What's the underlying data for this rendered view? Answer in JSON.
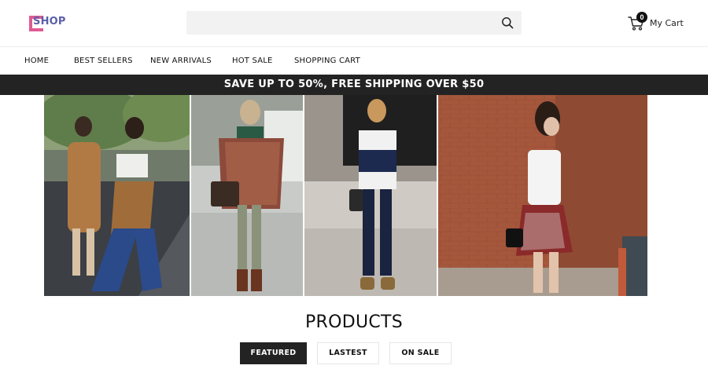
{
  "header": {
    "logo_text": "SHOP",
    "search": {
      "placeholder": "",
      "value": ""
    },
    "cart": {
      "count": "0",
      "label": "My Cart"
    }
  },
  "nav": {
    "items": [
      {
        "label": "HOME"
      },
      {
        "label": "BEST SELLERS"
      },
      {
        "label": "NEW ARRIVALS"
      },
      {
        "label": "HOT SALE"
      },
      {
        "label": "SHOPPING CART"
      }
    ]
  },
  "promo": {
    "text": "SAVE UP TO 50%, FREE SHIPPING OVER $50"
  },
  "products": {
    "title": "PRODUCTS",
    "tabs": [
      {
        "label": "FEATURED",
        "active": true
      },
      {
        "label": "LASTEST",
        "active": false
      },
      {
        "label": "ON SALE",
        "active": false
      }
    ]
  },
  "colors": {
    "logo_pink": "#e05a92",
    "logo_purple": "#5b5fa8",
    "promo_bg": "#232323",
    "search_bg": "#f2f2f2"
  },
  "icons": {
    "search": "search-icon",
    "cart": "cart-icon"
  }
}
